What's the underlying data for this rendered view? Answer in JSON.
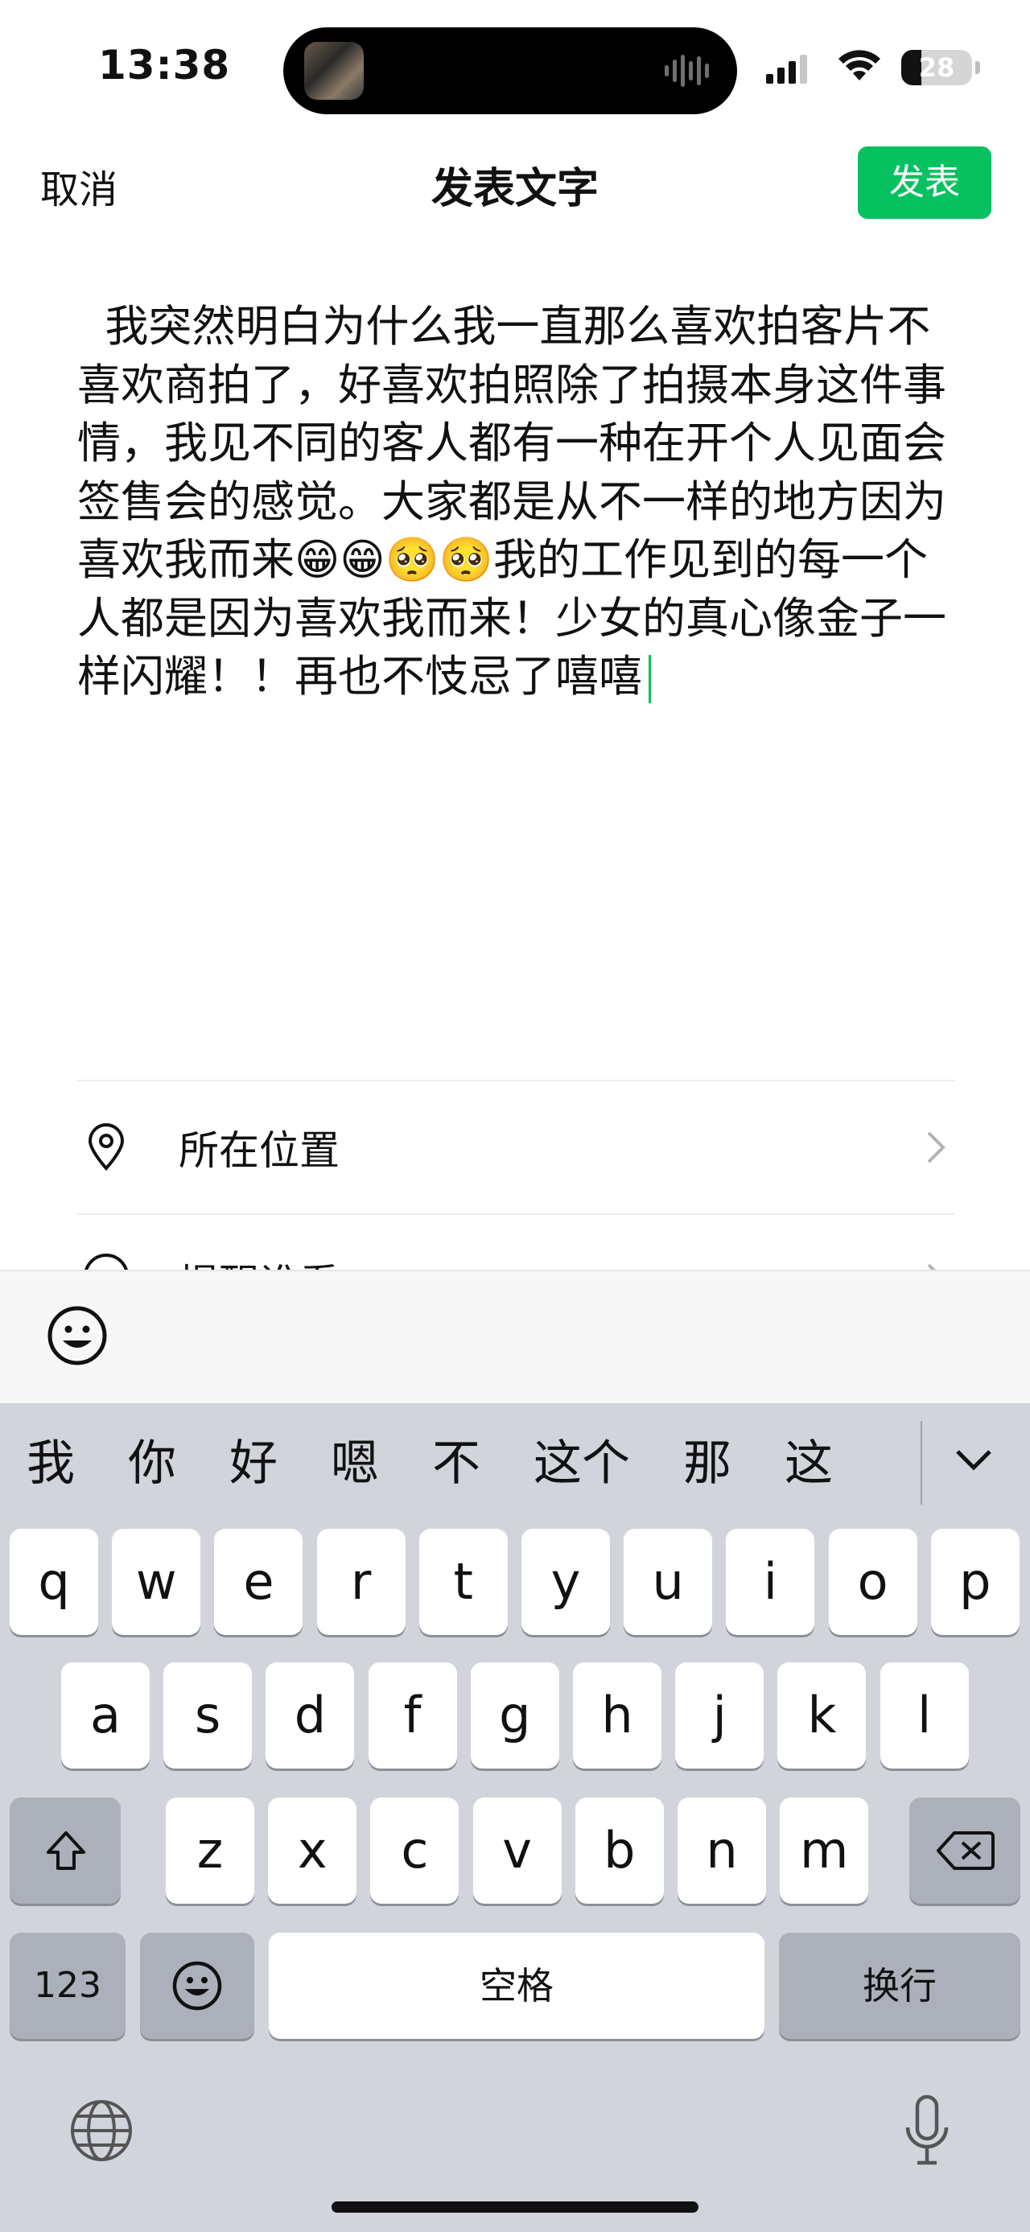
{
  "status": {
    "time": "13:38",
    "battery_level": "28",
    "battery_fraction": 0.28
  },
  "nav": {
    "cancel_label": "取消",
    "title": "发表文字",
    "post_label": "发表"
  },
  "post": {
    "text": "  我突然明白为什么我一直那么喜欢拍客片不喜欢商拍了，好喜欢拍照除了拍摄本身这件事情，我见不同的客人都有一种在开个人见面会签售会的感觉。大家都是从不一样的地方因为喜欢我而来😁😁🥺🥺我的工作见到的每一个人都是因为喜欢我而来！少女的真心像金子一样闪耀！！再也不忮忌了嘻嘻"
  },
  "options": {
    "location_label": "所在位置",
    "remind_label": "提醒谁看"
  },
  "keyboard": {
    "candidates": [
      "我",
      "你",
      "好",
      "嗯",
      "不",
      "这个",
      "那",
      "这"
    ],
    "row1": [
      "q",
      "w",
      "e",
      "r",
      "t",
      "y",
      "u",
      "i",
      "o",
      "p"
    ],
    "row2": [
      "a",
      "s",
      "d",
      "f",
      "g",
      "h",
      "j",
      "k",
      "l"
    ],
    "row3": [
      "z",
      "x",
      "c",
      "v",
      "b",
      "n",
      "m"
    ],
    "numbers_label": "123",
    "space_label": "空格",
    "return_label": "换行"
  },
  "icons": {
    "location": "location-pin-icon",
    "remind": "at-sign-icon",
    "emoji": "smiley-icon",
    "globe": "globe-icon",
    "mic": "microphone-icon",
    "shift": "shift-arrow-icon",
    "delete": "backspace-icon"
  },
  "colors": {
    "accent": "#07c160",
    "keyboard_bg": "#d1d4db",
    "key_dark": "#abb0bb"
  }
}
